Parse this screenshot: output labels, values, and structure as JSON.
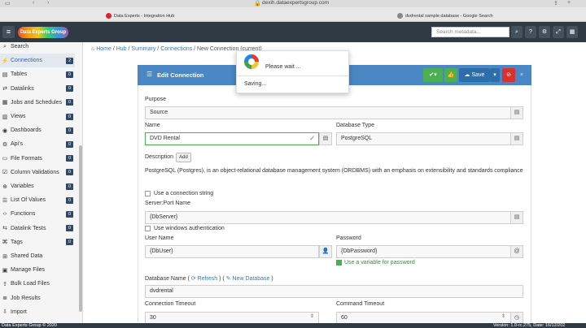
{
  "browser": {
    "url": "dexih.dataexpertsgroup.com",
    "tab1_title": "Data Experts - Integration Hub",
    "tab2_title": "dvdrental sample database - Google Search"
  },
  "header": {
    "logo_text": "Data Experts Group",
    "search_placeholder": "Search metadata...",
    "help_label": "?"
  },
  "sidebar": {
    "items": [
      {
        "label": "Search",
        "icon": "search-icon",
        "badge": ""
      },
      {
        "label": "Connections",
        "icon": "plug-icon",
        "badge": "2"
      },
      {
        "label": "Tables",
        "icon": "table-icon",
        "badge": "0"
      },
      {
        "label": "Datalinks",
        "icon": "link-icon",
        "badge": "0"
      },
      {
        "label": "Jobs and Schedules",
        "icon": "calendar-icon",
        "badge": "0"
      },
      {
        "label": "Views",
        "icon": "chart-icon",
        "badge": "0"
      },
      {
        "label": "Dashboards",
        "icon": "dashboard-icon",
        "badge": "0"
      },
      {
        "label": "Api's",
        "icon": "api-icon",
        "badge": "0"
      },
      {
        "label": "File Formats",
        "icon": "file-icon",
        "badge": "0"
      },
      {
        "label": "Column Validations",
        "icon": "check-square-icon",
        "badge": "0"
      },
      {
        "label": "Variables",
        "icon": "variable-icon",
        "badge": "0"
      },
      {
        "label": "List Of Values",
        "icon": "list-icon",
        "badge": "0"
      },
      {
        "label": "Functions",
        "icon": "code-icon",
        "badge": "0"
      },
      {
        "label": "Datalink Tests",
        "icon": "test-icon",
        "badge": "0"
      },
      {
        "label": "Tags",
        "icon": "tag-icon",
        "badge": "0"
      },
      {
        "label": "Shared Data",
        "icon": "shared-icon",
        "badge": ""
      },
      {
        "label": "Manage Files",
        "icon": "folder-icon",
        "badge": ""
      },
      {
        "label": "Bulk Load Files",
        "icon": "upload-icon",
        "badge": ""
      },
      {
        "label": "Job Results",
        "icon": "results-icon",
        "badge": ""
      },
      {
        "label": "Import",
        "icon": "import-icon",
        "badge": ""
      }
    ]
  },
  "breadcrumb": {
    "home": "Home",
    "hub": "Hub",
    "summary": "Summary",
    "connections": "Connections",
    "current": "New Connection (current)"
  },
  "panel": {
    "title": "Edit Connection",
    "save_label": "Save",
    "purpose_label": "Purpose",
    "purpose_value": "Source",
    "name_label": "Name",
    "name_value": "DVD Rental",
    "dbtype_label": "Database Type",
    "dbtype_value": "PostgreSQL",
    "description_label": "Description",
    "add_label": "Add",
    "description_text": "PostgreSQL (Postgres), is an object-relational database management system (ORDBMS) with an emphasis on extensibility and standards compliance",
    "use_connstring_label": "Use a connection string",
    "server_label": "Server:Port Name",
    "server_value": "{DbServer}",
    "windows_auth_label": "Use windows authentication",
    "user_label": "User Name",
    "user_value": "{DbUser}",
    "password_label": "Password",
    "password_value": "{DbPassword}",
    "password_var_label": "Use a variable for password",
    "dbname_label": "Database Name (",
    "refresh_label": "Refresh",
    "dbname_mid": ") (",
    "newdb_label": "New Database",
    "dbname_end": ")",
    "dbname_value": "dvdrental",
    "conn_timeout_label": "Connection Timeout",
    "conn_timeout_value": "30",
    "cmd_timeout_label": "Command Timeout",
    "cmd_timeout_value": "60"
  },
  "modal": {
    "title": "Please wait ...",
    "message": "Saving..."
  },
  "footer": {
    "copyright": "Data Experts Group © 2020",
    "version": "Version: 1.0-rc.275, Date: 16/12/202"
  },
  "colors": {
    "header_bg": "#2f3a45",
    "panel_head": "#4b87c4",
    "success": "#4caf50",
    "danger": "#d9322e"
  }
}
